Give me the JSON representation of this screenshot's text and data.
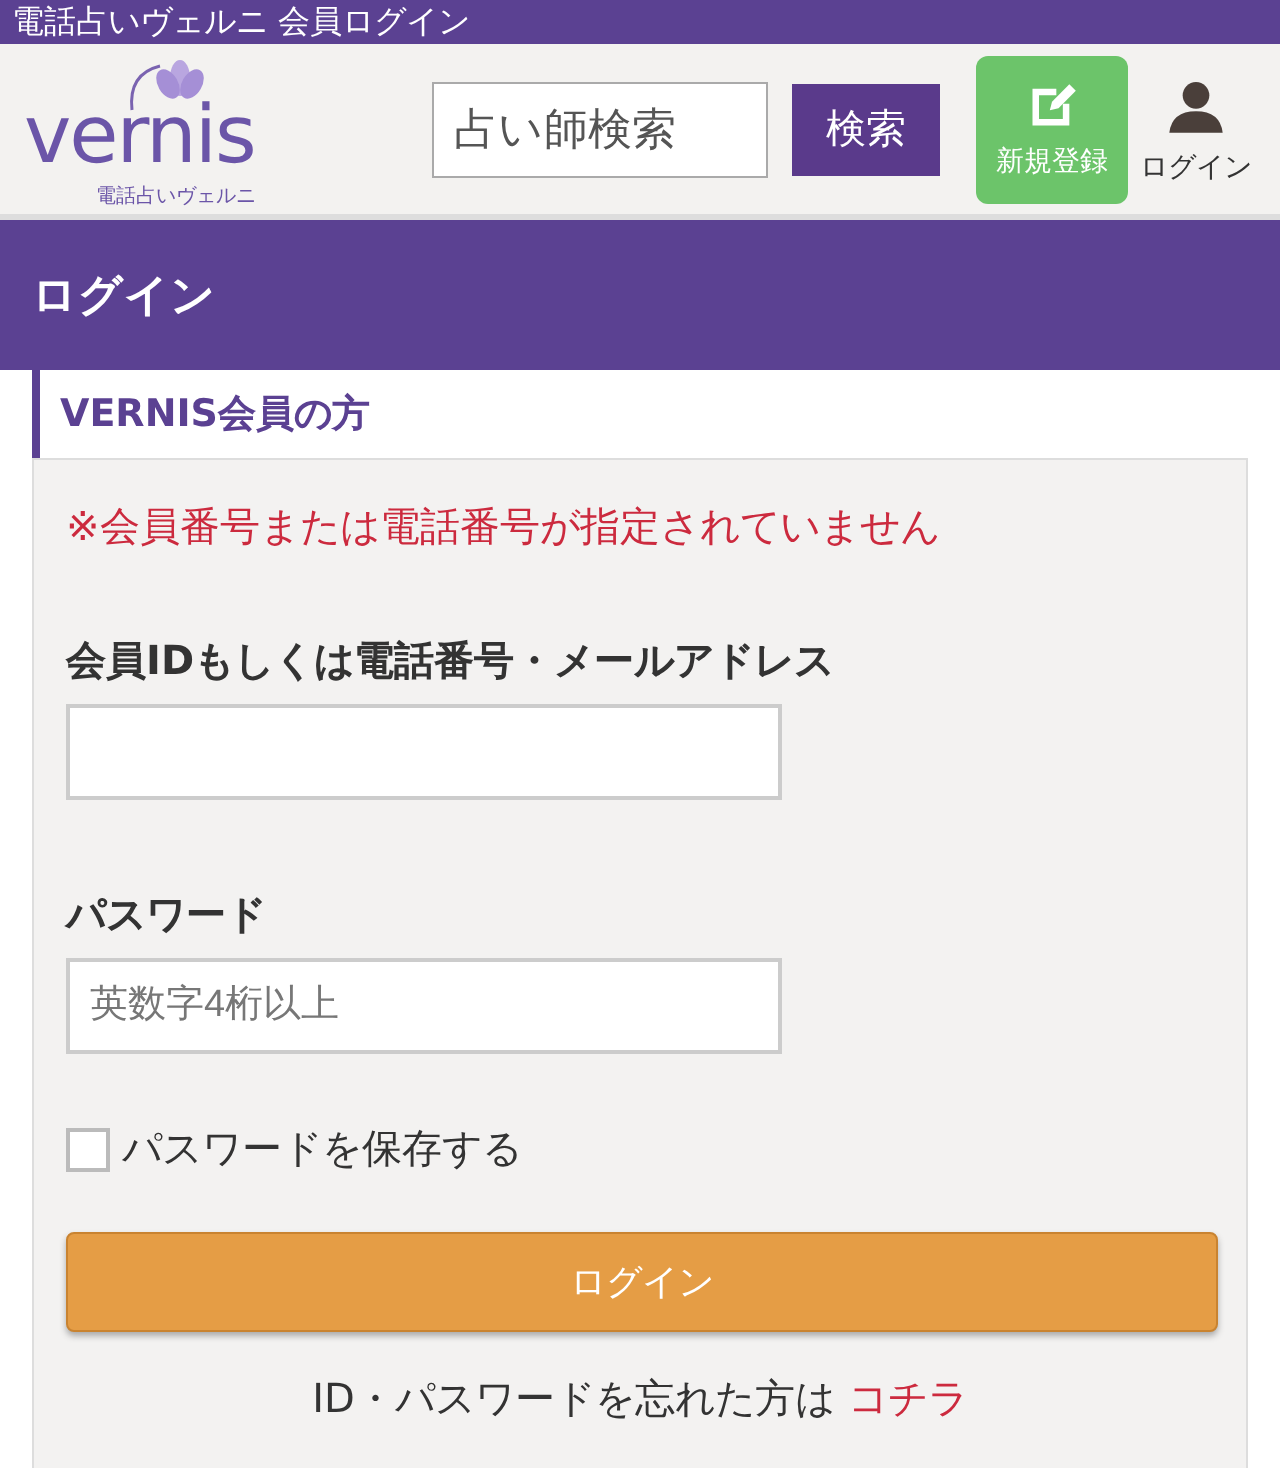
{
  "window": {
    "title": "電話占いヴェルニ 会員ログイン"
  },
  "header": {
    "logo": {
      "word": "vernis",
      "tagline": "電話占いヴェルニ"
    },
    "search": {
      "placeholder": "占い師検索"
    },
    "search_button": "検索",
    "register": "新規登録",
    "login": "ログイン"
  },
  "page_title": "ログイン",
  "section": {
    "title": "VERNIS会員の方",
    "error": "※会員番号または電話番号が指定されていません",
    "fields": [
      {
        "label": "会員IDもしくは電話番号・メールアドレス"
      },
      {
        "label": "パスワード",
        "placeholder": "英数字4桁以上"
      }
    ],
    "remember": {
      "label": "パスワードを保存する",
      "checked": false
    },
    "submit": "ログイン",
    "forgot": {
      "text": "ID・パスワードを忘れた方は",
      "link": "コチラ"
    }
  }
}
